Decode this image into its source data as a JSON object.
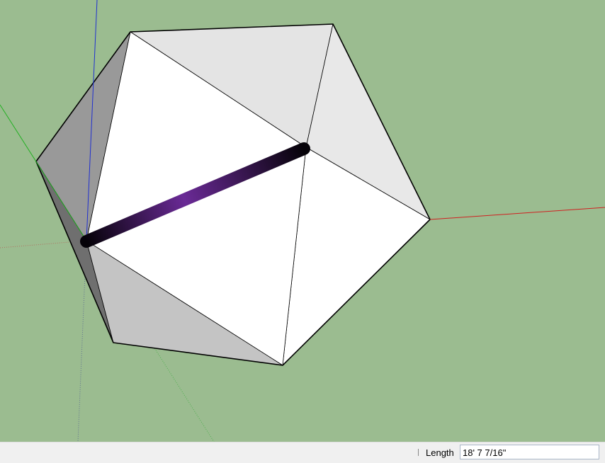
{
  "viewport": {
    "model": "icosahedron",
    "selection_tool_line": {
      "color_start": "#000000",
      "color_mid": "#6a2a96"
    },
    "axes_colors": {
      "red": "#d02020",
      "green": "#20b020",
      "blue": "#2020d0"
    }
  },
  "statusbar": {
    "vcb_label": "Length",
    "vcb_value": "18' 7 7/16\""
  }
}
